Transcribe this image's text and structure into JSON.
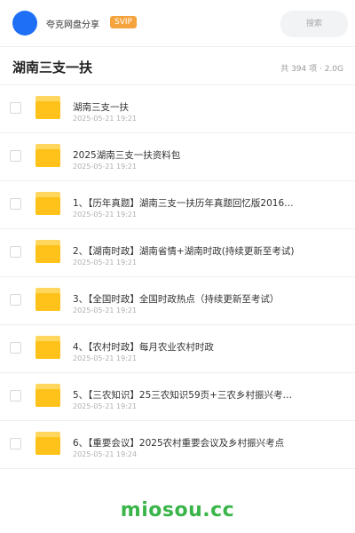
{
  "header": {
    "username": "夸克网盘分享",
    "badge": "SVIP",
    "search_placeholder": "搜索"
  },
  "folder": {
    "title": "湖南三支一扶",
    "summary": "共 394 项 · 2.0G"
  },
  "files": [
    {
      "name": "湖南三支一扶",
      "date": "2025-05-21 19:21"
    },
    {
      "name": "2025湖南三支一扶资料包",
      "date": "2025-05-21 19:21"
    },
    {
      "name": "1、【历年真题】湖南三支一扶历年真题回忆版2016…",
      "date": "2025-05-21 19:21"
    },
    {
      "name": "2、【湖南时政】湖南省情+湖南时政(持续更新至考试)",
      "date": "2025-05-21 19:21"
    },
    {
      "name": "3、【全国时政】全国时政热点（持续更新至考试）",
      "date": "2025-05-21 19:21"
    },
    {
      "name": "4、【农村时政】每月农业农村时政",
      "date": "2025-05-21 19:21"
    },
    {
      "name": "5、【三农知识】25三农知识59页+三农乡村振兴考…",
      "date": "2025-05-21 19:21"
    },
    {
      "name": "6、【重要会议】2025农村重要会议及乡村振兴考点",
      "date": "2025-05-21 19:24"
    }
  ],
  "watermark": "miosou.cc",
  "colors": {
    "accent": "#1e6ff5",
    "badge": "#f5a33c",
    "folder": "#ffc21a",
    "watermark": "#3ab54a"
  }
}
